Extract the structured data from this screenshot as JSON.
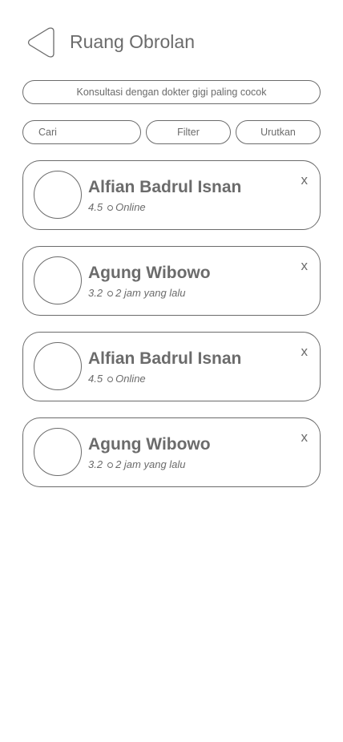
{
  "header": {
    "back_icon": "chevron-left-triangle-icon",
    "title": "Ruang Obrolan"
  },
  "banner": {
    "text": "Konsultasi dengan dokter gigi paling cocok"
  },
  "controls": {
    "search_placeholder": "Cari",
    "filter_label": "Filter",
    "sort_label": "Urutkan"
  },
  "doctors": [
    {
      "name": "Alfian Badrul Isnan",
      "rating": "4.5",
      "status": "Online",
      "close_label": "x"
    },
    {
      "name": "Agung Wibowo",
      "rating": "3.2",
      "status": "2 jam yang lalu",
      "close_label": "x"
    },
    {
      "name": "Alfian Badrul Isnan",
      "rating": "4.5",
      "status": "Online",
      "close_label": "x"
    },
    {
      "name": "Agung Wibowo",
      "rating": "3.2",
      "status": "2 jam yang lalu",
      "close_label": "x"
    }
  ],
  "colors": {
    "stroke": "#6b6b6b",
    "background": "#ffffff"
  }
}
